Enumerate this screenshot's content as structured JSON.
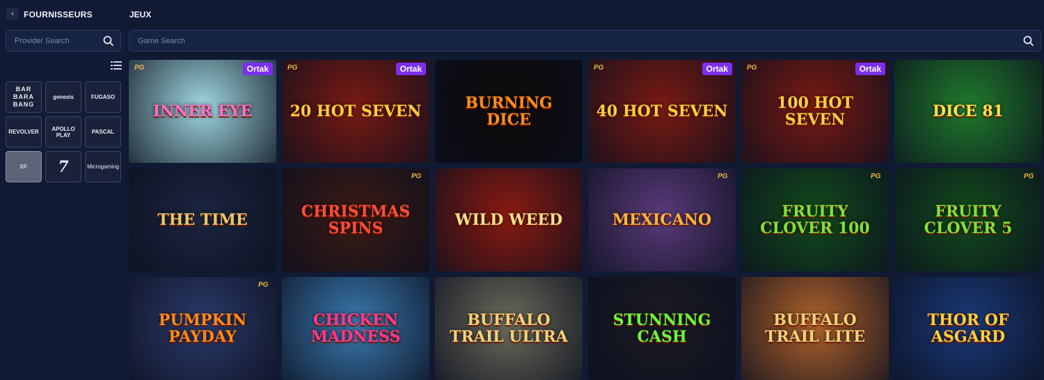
{
  "sidebar": {
    "back_symbol": "‹",
    "title": "FOURNISSEURS",
    "search_placeholder": "Provider Search",
    "providers": [
      {
        "label": "BAR BARA BANG",
        "style": "bar"
      },
      {
        "label": "genesis",
        "style": "plain"
      },
      {
        "label": "FUGASO",
        "style": "plain"
      },
      {
        "label": "REVOLVER",
        "style": "plain"
      },
      {
        "label": "APOLLO PLAY",
        "style": "plain"
      },
      {
        "label": "PASCAL",
        "style": "plain"
      },
      {
        "label": "BF",
        "style": "active"
      },
      {
        "label": "7",
        "style": "seven"
      },
      {
        "label": "Microgaming",
        "style": "micro"
      }
    ]
  },
  "main": {
    "title": "JEUX",
    "search_placeholder": "Game Search"
  },
  "games": [
    {
      "name": "INNER EYE",
      "bg": "#9fd7df",
      "color": "#ff6fc8",
      "badge": "Ortak",
      "pg": "left"
    },
    {
      "name": "20 HOT SEVEN",
      "bg": "#7a1a12",
      "color": "#ffcf3a",
      "badge": "Ortak",
      "pg": "left"
    },
    {
      "name": "BURNING DICE",
      "bg": "#0d0a08",
      "color": "#ff8c1a",
      "badge": "",
      "pg": ""
    },
    {
      "name": "40 HOT SEVEN",
      "bg": "#7a1a12",
      "color": "#ffcf3a",
      "badge": "Ortak",
      "pg": "left"
    },
    {
      "name": "100 HOT SEVEN",
      "bg": "#7a1a12",
      "color": "#ffcf3a",
      "badge": "Ortak",
      "pg": "left"
    },
    {
      "name": "DICE 81",
      "bg": "#1f7a2b",
      "color": "#ffe14a",
      "badge": "",
      "pg": ""
    },
    {
      "name": "THE TIME",
      "bg": "#1c2540",
      "color": "#e9c86a",
      "badge": "",
      "pg": ""
    },
    {
      "name": "CHRISTMAS SPINS",
      "bg": "#3a1a14",
      "color": "#ff4d3a",
      "badge": "",
      "pg": "right"
    },
    {
      "name": "WILD WEED",
      "bg": "#8a1a10",
      "color": "#ffe18a",
      "badge": "",
      "pg": ""
    },
    {
      "name": "MEXICANO",
      "bg": "#5a3a7a",
      "color": "#ffb43a",
      "badge": "",
      "pg": "right"
    },
    {
      "name": "FRUITY CLOVER 100",
      "bg": "#124a1c",
      "color": "#7fe13a",
      "badge": "",
      "pg": "right"
    },
    {
      "name": "FRUITY CLOVER 5",
      "bg": "#124a1c",
      "color": "#7fe13a",
      "badge": "",
      "pg": "right"
    },
    {
      "name": "PUMPKIN PAYDAY",
      "bg": "#2b3a6a",
      "color": "#ff8a1a",
      "badge": "",
      "pg": "right"
    },
    {
      "name": "CHICKEN MADNESS",
      "bg": "#3a7ab0",
      "color": "#ff3a8a",
      "badge": "",
      "pg": ""
    },
    {
      "name": "BUFFALO TRAIL ULTRA",
      "bg": "#6a6a5a",
      "color": "#f2d27a",
      "badge": "",
      "pg": ""
    },
    {
      "name": "STUNNING CASH",
      "bg": "#1a1a24",
      "color": "#6aff3a",
      "badge": "",
      "pg": ""
    },
    {
      "name": "BUFFALO TRAIL LITE",
      "bg": "#b0622a",
      "color": "#f2d27a",
      "badge": "",
      "pg": ""
    },
    {
      "name": "THOR OF ASGARD",
      "bg": "#1a3a7a",
      "color": "#ffcf3a",
      "badge": "",
      "pg": ""
    }
  ]
}
